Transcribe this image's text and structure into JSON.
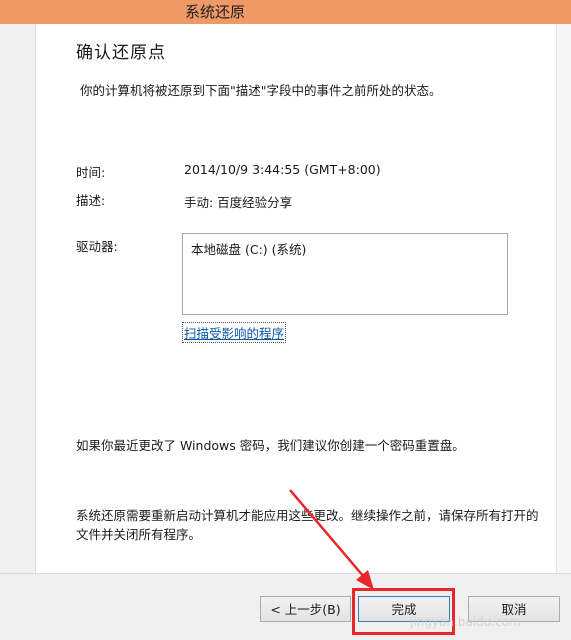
{
  "window": {
    "title": "系统还原",
    "accent_color": "#ef9a66"
  },
  "page": {
    "heading": "确认还原点",
    "description": "你的计算机将被还原到下面\"描述\"字段中的事件之前所处的状态。"
  },
  "details": {
    "time_label": "时间:",
    "time_value": "2014/10/9 3:44:55 (GMT+8:00)",
    "desc_label": "描述:",
    "desc_value": "手动: 百度经验分享",
    "drives_label": "驱动器:",
    "drives": [
      "本地磁盘 (C:) (系统)"
    ],
    "scan_link": "扫描受影响的程序"
  },
  "notes": {
    "password_note": "如果你最近更改了 Windows 密码，我们建议你创建一个密码重置盘。",
    "restart_note": "系统还原需要重新启动计算机才能应用这些更改。继续操作之前，请保存所有打开的文件并关闭所有程序。"
  },
  "buttons": {
    "back": "< 上一步(B)",
    "finish": "完成",
    "cancel": "取消"
  },
  "annotation": {
    "color": "#e8262b"
  },
  "watermark": "jingyan.baidu.com"
}
